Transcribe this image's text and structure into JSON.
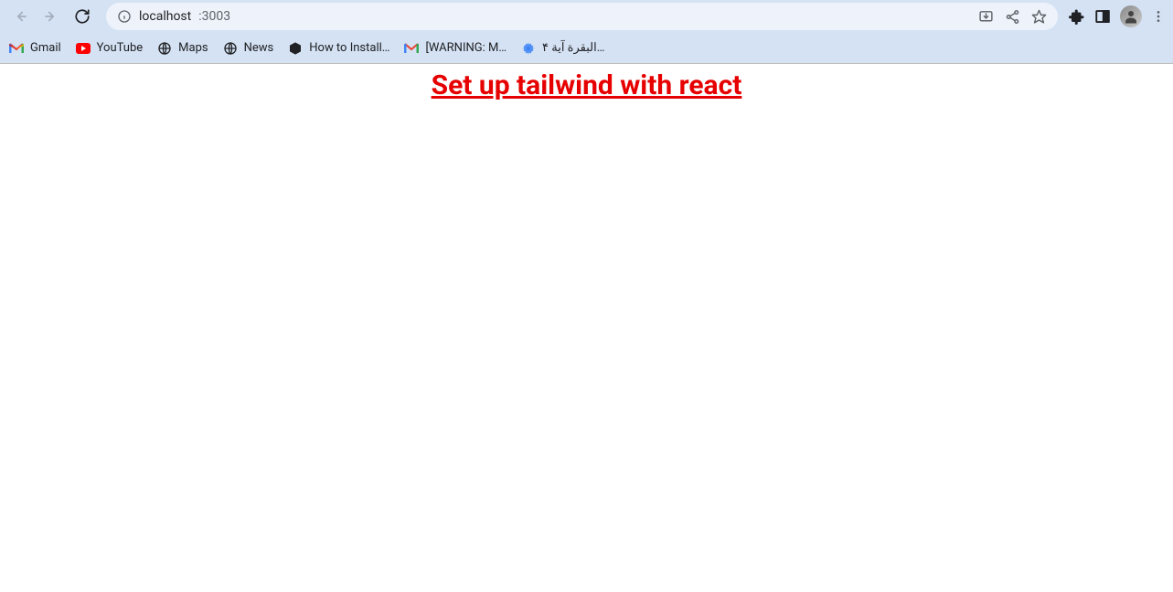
{
  "toolbar": {
    "url_host": "localhost",
    "url_port": ":3003"
  },
  "bookmarks": [
    {
      "label": "Gmail",
      "icon": "gmail"
    },
    {
      "label": "YouTube",
      "icon": "youtube"
    },
    {
      "label": "Maps",
      "icon": "globe"
    },
    {
      "label": "News",
      "icon": "globe"
    },
    {
      "label": "How to Install…",
      "icon": "hex"
    },
    {
      "label": "[WARNING: M…",
      "icon": "gmail"
    },
    {
      "label": "البقرة آية ۴…",
      "icon": "blue-gear"
    }
  ],
  "page": {
    "heading": "Set up tailwind with react"
  }
}
